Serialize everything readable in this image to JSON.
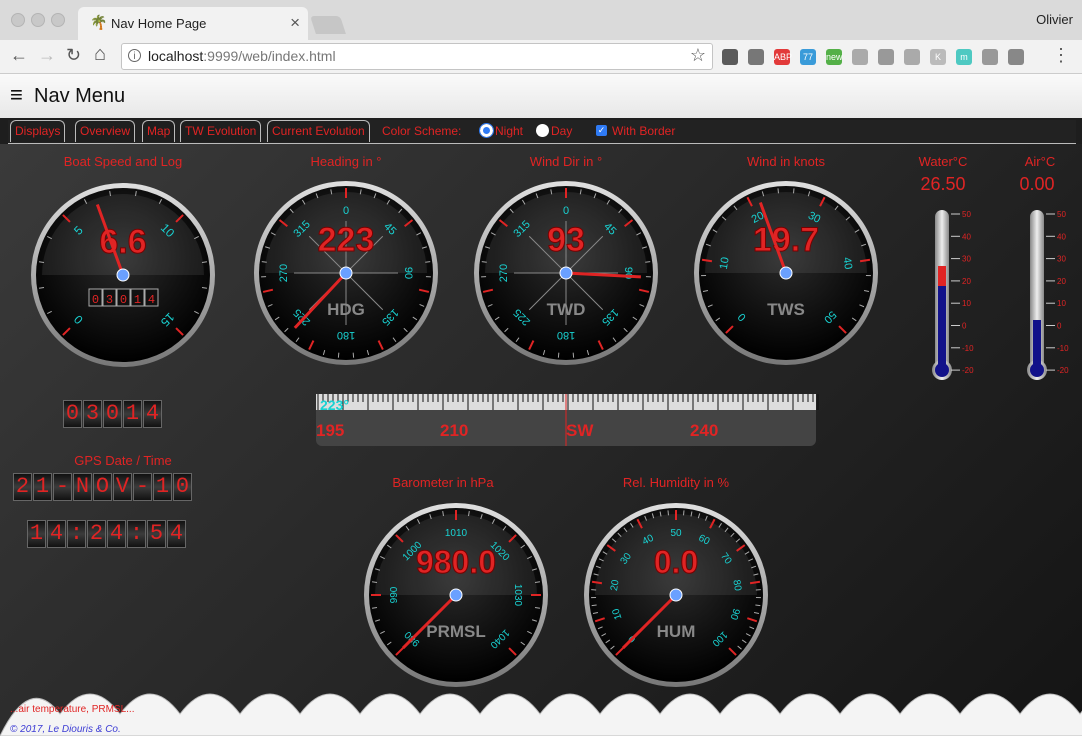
{
  "browser": {
    "tab_title": "Nav Home Page",
    "tab_close": "×",
    "user": "Olivier",
    "url_host": "localhost",
    "url_path": ":9999/web/index.html",
    "back_glyph": "←",
    "forward_glyph": "→",
    "reload_glyph": "↻",
    "home_glyph": "⌂",
    "star_glyph": "☆",
    "menu_glyph": "⋮",
    "extensions": [
      {
        "name": "evernote-icon",
        "label": "",
        "color": "#5a5a5a"
      },
      {
        "name": "bug-icon",
        "label": "",
        "color": "#777"
      },
      {
        "name": "adblock-icon",
        "label": "ABP",
        "color": "#e23a3a"
      },
      {
        "name": "weather-icon",
        "label": "77",
        "color": "#3a9bd9"
      },
      {
        "name": "new-icon",
        "label": "new",
        "color": "#54b048"
      },
      {
        "name": "circle-icon",
        "label": "",
        "color": "#aaa"
      },
      {
        "name": "grid-icon",
        "label": "",
        "color": "#999"
      },
      {
        "name": "cube-icon",
        "label": "",
        "color": "#aaa"
      },
      {
        "name": "k-icon",
        "label": "K",
        "color": "#bbb"
      },
      {
        "name": "m-icon",
        "label": "m",
        "color": "#4ec9c2"
      },
      {
        "name": "music-icon",
        "label": "",
        "color": "#999"
      },
      {
        "name": "box-icon",
        "label": "",
        "color": "#888"
      }
    ]
  },
  "page": {
    "title": "Nav Menu",
    "hamburger": "≡",
    "tabs": [
      "Displays",
      "Overview",
      "Map",
      "TW Evolution",
      "Current Evolution"
    ],
    "color_scheme_label": "Color Scheme:",
    "night_label": "Night",
    "day_label": "Day",
    "border_label": "With Border",
    "night_selected": true,
    "day_selected": false,
    "border_checked": true
  },
  "gauges": {
    "bsp": {
      "title": "Boat Speed and Log",
      "value": "6.6",
      "ticks": [
        "0",
        "5",
        "10",
        "15"
      ],
      "log": "03014"
    },
    "hdg": {
      "title": "Heading in °",
      "value": "223",
      "label": "HDG",
      "ticks": [
        "0",
        "45",
        "90",
        "135",
        "180",
        "225",
        "270",
        "315"
      ]
    },
    "twd": {
      "title": "Wind Dir in °",
      "value": "93",
      "label": "TWD",
      "ticks": [
        "0",
        "45",
        "90",
        "135",
        "180",
        "225",
        "270",
        "315"
      ]
    },
    "tws": {
      "title": "Wind in knots",
      "value": "19.7",
      "label": "TWS",
      "ticks": [
        "0",
        "10",
        "20",
        "30",
        "40",
        "50"
      ]
    },
    "baro": {
      "title": "Barometer in hPa",
      "value": "980.0",
      "label": "PRMSL",
      "ticks": [
        "980",
        "990",
        "1000",
        "1010",
        "1020",
        "1030",
        "1040"
      ]
    },
    "hum": {
      "title": "Rel. Humidity in %",
      "value": "0.0",
      "label": "HUM",
      "ticks": [
        "0",
        "10",
        "20",
        "30",
        "40",
        "50",
        "60",
        "70",
        "80",
        "90",
        "100"
      ]
    }
  },
  "thermometers": {
    "water": {
      "title": "Water°C",
      "value": "26.50",
      "ticks": [
        "50",
        "40",
        "30",
        "20",
        "10",
        "0",
        "-10",
        "-20"
      ]
    },
    "air": {
      "title": "Air°C",
      "value": "0.00",
      "ticks": [
        "50",
        "40",
        "30",
        "20",
        "10",
        "0",
        "-10",
        "-20"
      ]
    }
  },
  "log_counter": "03014",
  "compass_rose": {
    "current": "223°",
    "labels": [
      "195",
      "210",
      "SW",
      "240"
    ]
  },
  "gps": {
    "title": "GPS Date / Time",
    "date": "21-NOV-10",
    "time": "14:24:54"
  },
  "footer": {
    "text": "© 2017, Le Diouris & Co.",
    "note": "...air temperature, PRMSL..."
  },
  "colors": {
    "accent": "#e02424",
    "tick": "#19d3d3",
    "background": "#1e1e1e"
  }
}
